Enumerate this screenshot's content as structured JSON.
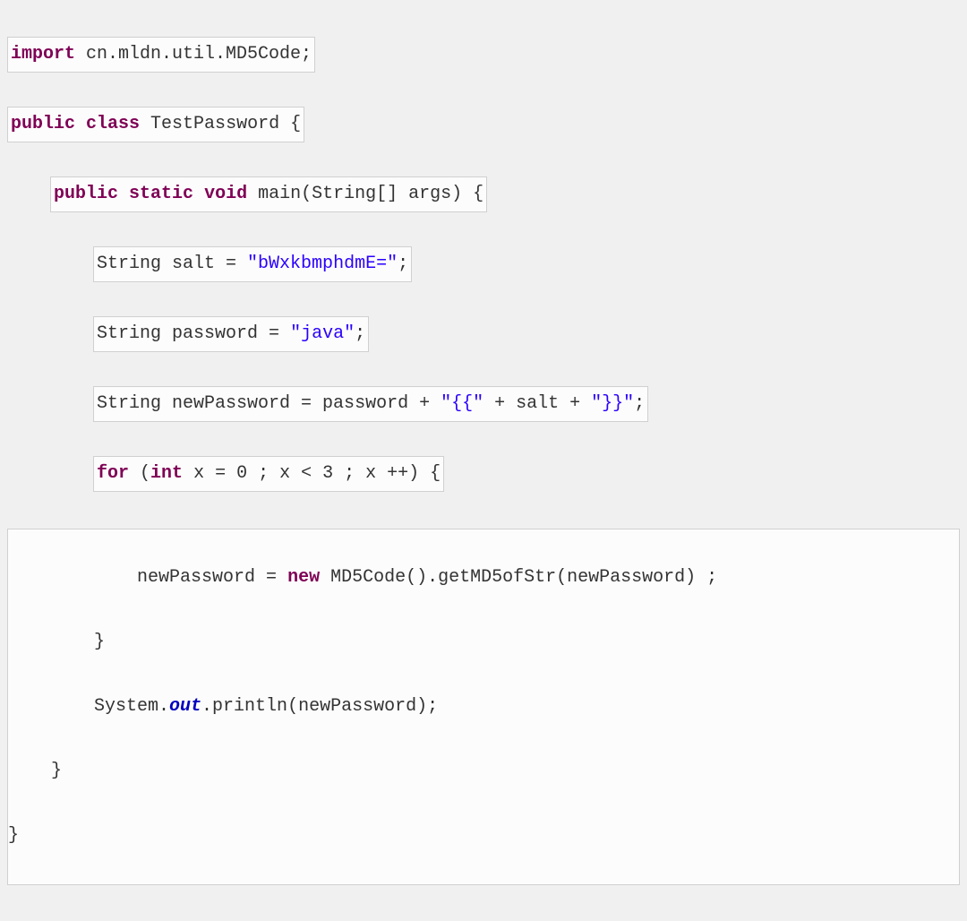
{
  "code": {
    "line1": {
      "kw": "import",
      "t": " cn.mldn.util.MD5Code;"
    },
    "line2": {
      "kw1": "public",
      "kw2": "class",
      "name": " TestPassword ",
      "brace": "{"
    },
    "line3": {
      "kw1": "public",
      "kw2": "static",
      "kw3": "void",
      "fn": " main(String[] args) {"
    },
    "line4": {
      "pre": "String salt = ",
      "str": "\"bWxkbmphdmE=\"",
      "post": ";"
    },
    "line5": {
      "pre": "String password = ",
      "str": "\"java\"",
      "post": ";"
    },
    "line6": {
      "pre": "String newPassword = password + ",
      "s1": "\"{{\"",
      "mid1": " + salt + ",
      "s2": "\"}}\"",
      "post": ";"
    },
    "line7": {
      "kw1": "for",
      "p1": " (",
      "kw2": "int",
      "p2": " x = 0 ; x < 3 ; x ++) {"
    },
    "line8": {
      "pre": "            newPassword = ",
      "kw": "new",
      "post": " MD5Code().getMD5ofStr(newPassword) ;"
    },
    "line9": "        }",
    "line10": {
      "pre": "        System.",
      "out": "out",
      "post": ".println(newPassword);"
    },
    "line11": "    }",
    "line12": "}"
  }
}
